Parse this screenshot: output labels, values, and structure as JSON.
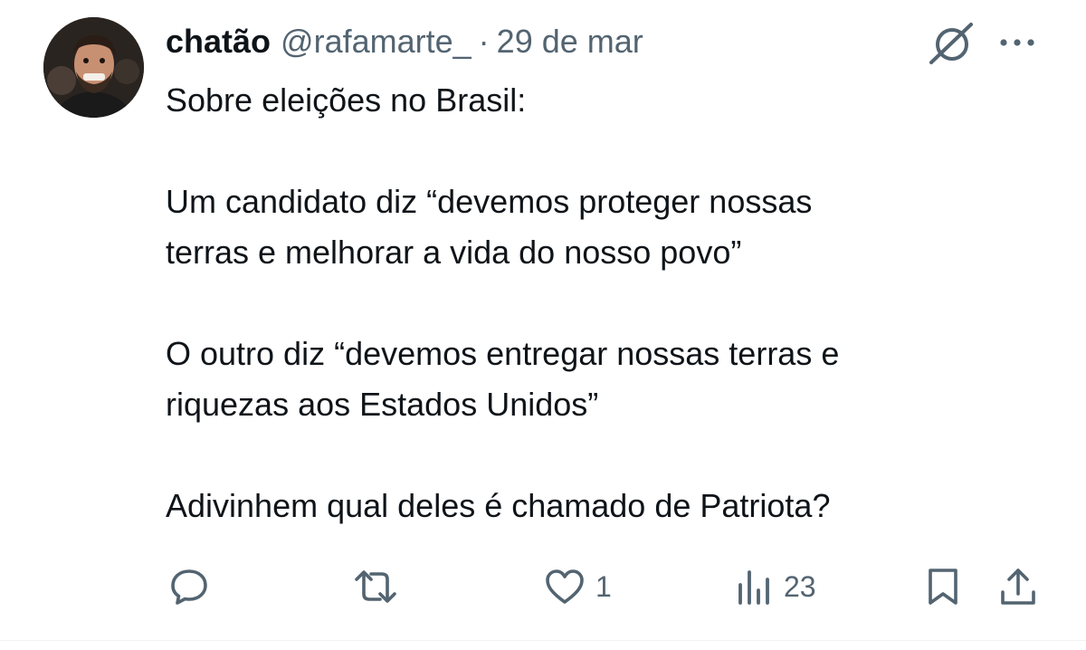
{
  "tweet": {
    "display_name": "chatão",
    "handle": "@rafamarte_",
    "separator": "·",
    "date": "29 de mar",
    "lines": [
      "Sobre eleições no Brasil:",
      "",
      "Um candidato diz “devemos proteger nossas",
      "terras e melhorar a vida do nosso povo”",
      "",
      "O outro diz “devemos entregar nossas terras e",
      "riquezas aos Estados Unidos”",
      "",
      "Adivinhem qual deles é chamado de Patriota?"
    ]
  },
  "actions": {
    "reply": {
      "icon": "reply-icon",
      "count": ""
    },
    "retweet": {
      "icon": "retweet-icon",
      "count": ""
    },
    "like": {
      "icon": "heart-icon",
      "count": "1"
    },
    "views": {
      "icon": "views-icon",
      "count": "23"
    },
    "bookmark": {
      "icon": "bookmark-icon"
    },
    "share": {
      "icon": "share-icon"
    }
  },
  "header_icons": {
    "grok": "grok-icon",
    "more": "more-icon"
  },
  "colors": {
    "text_primary": "#0f1419",
    "text_secondary": "#536471",
    "background": "#ffffff"
  }
}
